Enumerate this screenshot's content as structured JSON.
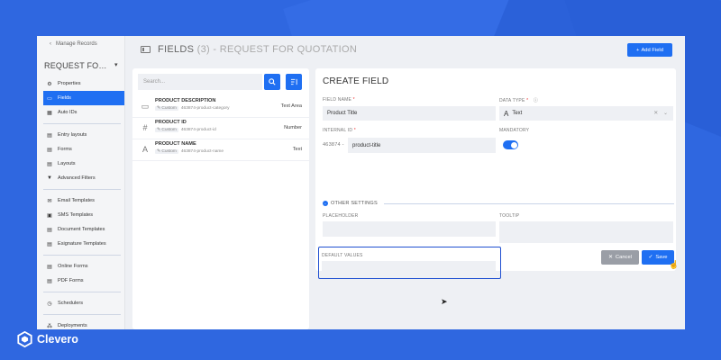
{
  "brand": {
    "name": "Clevero"
  },
  "sidebar": {
    "back_link": "Manage Records",
    "title": "REQUEST FOR QU...",
    "groups": [
      [
        {
          "label": "Properties",
          "icon": "gear-icon"
        },
        {
          "label": "Fields",
          "icon": "field-icon",
          "active": true
        },
        {
          "label": "Auto IDs",
          "icon": "grid-icon"
        }
      ],
      [
        {
          "label": "Entry layouts",
          "icon": "doc-icon"
        },
        {
          "label": "Forms",
          "icon": "doc-icon"
        },
        {
          "label": "Layouts",
          "icon": "doc-icon"
        },
        {
          "label": "Advanced Filters",
          "icon": "filter-icon"
        }
      ],
      [
        {
          "label": "Email Templates",
          "icon": "mail-icon"
        },
        {
          "label": "SMS Templates",
          "icon": "sms-icon"
        },
        {
          "label": "Document Templates",
          "icon": "doc-icon"
        },
        {
          "label": "Esignature Templates",
          "icon": "doc-icon"
        }
      ],
      [
        {
          "label": "Online Forms",
          "icon": "doc-icon"
        },
        {
          "label": "PDF Forms",
          "icon": "doc-icon"
        }
      ],
      [
        {
          "label": "Schedulers",
          "icon": "clock-icon"
        }
      ],
      [
        {
          "label": "Deployments",
          "icon": "deploy-icon"
        }
      ]
    ]
  },
  "header": {
    "title": "FIELDS",
    "count": "(3)",
    "subtitle": "- REQUEST FOR QUOTATION",
    "add_field_label": "Add Field"
  },
  "field_list": {
    "search_placeholder": "Search...",
    "items": [
      {
        "name": "PRODUCT DESCRIPTION",
        "tag": "Custom",
        "key": "463874-product-category",
        "type": "Text Area",
        "icon": "textarea-icon"
      },
      {
        "name": "PRODUCT ID",
        "tag": "Custom",
        "key": "463874-product-id",
        "type": "Number",
        "icon": "hash-icon"
      },
      {
        "name": "PRODUCT NAME",
        "tag": "Custom",
        "key": "463874-product-name",
        "type": "Text",
        "icon": "text-icon"
      }
    ]
  },
  "create_field": {
    "title": "CREATE FIELD",
    "field_name_label": "FIELD NAME",
    "field_name_value": "Product Title",
    "data_type_label": "DATA TYPE",
    "data_type_value": "Text",
    "internal_id_label": "INTERNAL ID",
    "internal_id_prefix": "463874 -",
    "internal_id_value": "product-title",
    "mandatory_label": "MANDATORY",
    "mandatory_on": true,
    "other_settings_label": "OTHER SETTINGS",
    "placeholder_label": "PLACEHOLDER",
    "tooltip_label": "TOOLTIP",
    "default_values_label": "DEFAULT VALUES",
    "cancel_label": "Cancel",
    "save_label": "Save"
  },
  "colors": {
    "accent": "#1f6ff2",
    "background": "#2f67e0"
  }
}
